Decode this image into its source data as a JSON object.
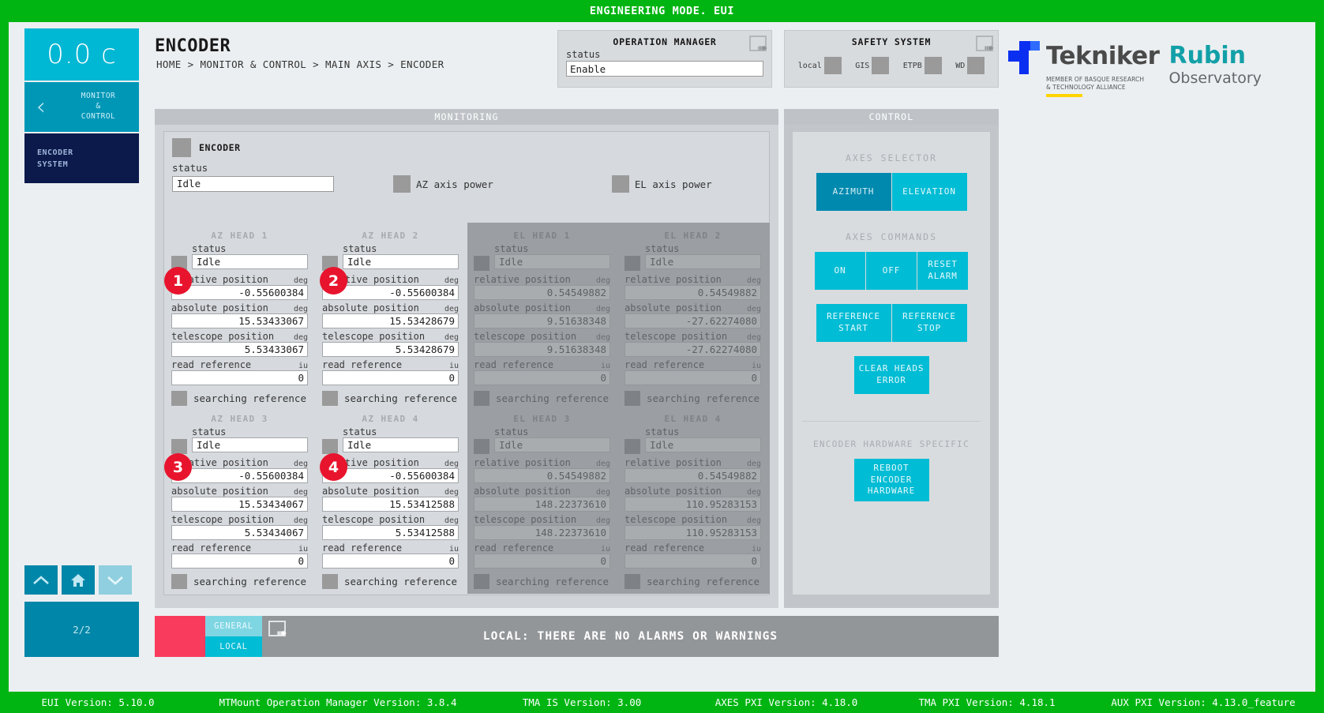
{
  "topbar": {
    "title": "ENGINEERING MODE. EUI"
  },
  "sidebar": {
    "clock": "0.0 c",
    "nav_monitor_control": "MONITOR\n&\nCONTROL",
    "nav_monitor_control_lines": [
      "MONITOR",
      "&",
      "CONTROL"
    ],
    "nav_active_lines": [
      "ENCODER",
      "SYSTEM"
    ],
    "arrow_up": "up-chevron",
    "arrow_home": "home",
    "arrow_down": "down-chevron",
    "page_indicator": "2/2"
  },
  "header": {
    "title": "ENCODER",
    "breadcrumb": "HOME > MONITOR & CONTROL > MAIN AXIS > ENCODER"
  },
  "operation_manager": {
    "title": "OPERATION MANAGER",
    "status_label": "status",
    "status_value": "Enable"
  },
  "safety_system": {
    "title": "SAFETY SYSTEM",
    "items": [
      {
        "label": "local",
        "state": "off"
      },
      {
        "label": "GIS",
        "state": "off"
      },
      {
        "label": "ETPB",
        "state": "off"
      },
      {
        "label": "WD",
        "state": "off"
      }
    ]
  },
  "logos": {
    "tekniker": "Tekniker",
    "tekniker_sub_line1": "MEMBER OF BASQUE RESEARCH",
    "tekniker_sub_line2": "& TECHNOLOGY ALLIANCE",
    "rubin_line1": "Rubin",
    "rubin_line2": "Observatory"
  },
  "panels": {
    "monitoring_title": "MONITORING",
    "control_title": "CONTROL"
  },
  "encoder": {
    "card_title": "ENCODER",
    "status_label": "status",
    "status_value": "Idle",
    "az_axis_power_label": "AZ axis power",
    "el_axis_power_label": "EL axis power"
  },
  "field_labels": {
    "status": "status",
    "relative_position": "relative position",
    "absolute_position": "absolute position",
    "telescope_position": "telescope position",
    "read_reference": "read reference",
    "searching_reference": "searching reference",
    "unit_deg": "deg",
    "unit_iu": "iu"
  },
  "heads": {
    "az": [
      {
        "title": "AZ HEAD 1",
        "badge": "1",
        "status": "Idle",
        "relative_position": "-0.55600384",
        "absolute_position": "15.53433067",
        "telescope_position": "5.53433067",
        "read_reference": "0"
      },
      {
        "title": "AZ HEAD 2",
        "badge": "2",
        "status": "Idle",
        "relative_position": "-0.55600384",
        "absolute_position": "15.53428679",
        "telescope_position": "5.53428679",
        "read_reference": "0"
      },
      {
        "title": "AZ HEAD 3",
        "badge": "3",
        "status": "Idle",
        "relative_position": "-0.55600384",
        "absolute_position": "15.53434067",
        "telescope_position": "5.53434067",
        "read_reference": "0"
      },
      {
        "title": "AZ HEAD 4",
        "badge": "4",
        "status": "Idle",
        "relative_position": "-0.55600384",
        "absolute_position": "15.53412588",
        "telescope_position": "5.53412588",
        "read_reference": "0"
      }
    ],
    "el": [
      {
        "title": "EL HEAD 1",
        "status": "Idle",
        "relative_position": "0.54549882",
        "absolute_position": "9.51638348",
        "telescope_position": "9.51638348",
        "read_reference": "0"
      },
      {
        "title": "EL HEAD 2",
        "status": "Idle",
        "relative_position": "0.54549882",
        "absolute_position": "-27.62274080",
        "telescope_position": "-27.62274080",
        "read_reference": "0"
      },
      {
        "title": "EL HEAD 3",
        "status": "Idle",
        "relative_position": "0.54549882",
        "absolute_position": "148.22373610",
        "telescope_position": "148.22373610",
        "read_reference": "0"
      },
      {
        "title": "EL HEAD 4",
        "status": "Idle",
        "relative_position": "0.54549882",
        "absolute_position": "110.95283153",
        "telescope_position": "110.95283153",
        "read_reference": "0"
      }
    ]
  },
  "control": {
    "axes_selector_title": "AXES SELECTOR",
    "axes_selector": [
      {
        "label": "AZIMUTH",
        "selected": true
      },
      {
        "label": "ELEVATION",
        "selected": false
      }
    ],
    "axes_commands_title": "AXES COMMANDS",
    "commands_row1": [
      "ON",
      "OFF",
      "RESET\nALARM"
    ],
    "cmd_on": "ON",
    "cmd_off": "OFF",
    "cmd_reset_alarm_l1": "RESET",
    "cmd_reset_alarm_l2": "ALARM",
    "cmd_ref_start_l1": "REFERENCE",
    "cmd_ref_start_l2": "START",
    "cmd_ref_stop_l1": "REFERENCE",
    "cmd_ref_stop_l2": "STOP",
    "cmd_clear_heads_l1": "CLEAR HEADS",
    "cmd_clear_heads_l2": "ERROR",
    "hardware_title": "ENCODER HARDWARE SPECIFIC",
    "cmd_reboot_l1": "REBOOT",
    "cmd_reboot_l2": "ENCODER",
    "cmd_reboot_l3": "HARDWARE"
  },
  "alarm_bar": {
    "tab_general": "GENERAL",
    "tab_local": "LOCAL",
    "message": "LOCAL: THERE ARE NO ALARMS OR WARNINGS"
  },
  "versions": {
    "eui": "EUI Version: 5.10.0",
    "mtmount": "MTMount Operation Manager Version: 3.8.4",
    "tma_is": "TMA IS Version: 3.00",
    "axes_pxi": "AXES PXI Version: 4.18.0",
    "tma_pxi": "TMA PXI Version: 4.18.1",
    "aux_pxi": "AUX PXI Version: 4.13.0_feature"
  },
  "colors": {
    "green": "#00b512",
    "cyan": "#00bcd4",
    "cyan_dark": "#0089ae",
    "red": "#f93b5e",
    "navy": "#0b1a4a"
  }
}
